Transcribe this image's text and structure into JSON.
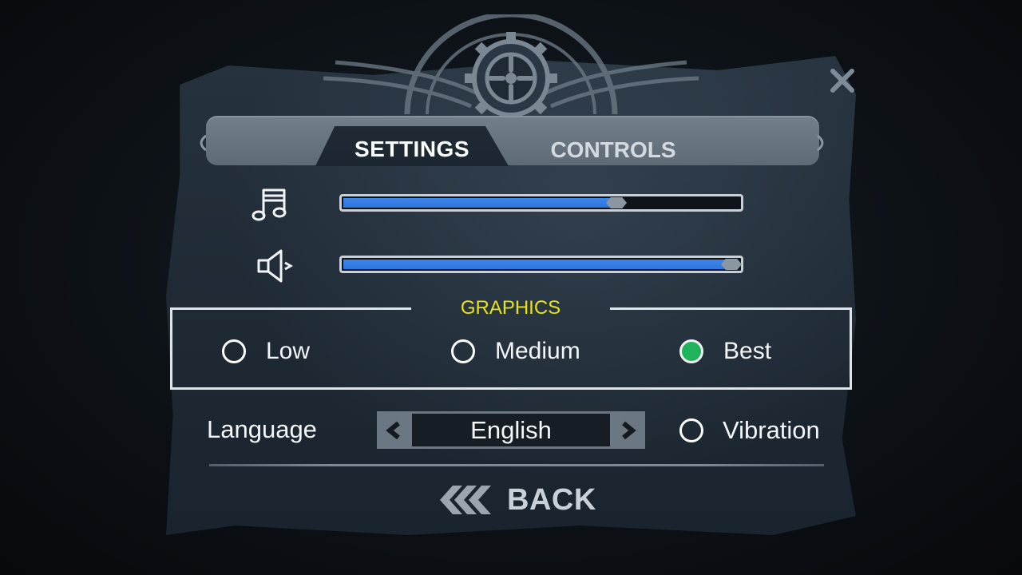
{
  "tabs": {
    "settings_label": "SETTINGS",
    "controls_label": "CONTROLS",
    "active": "settings"
  },
  "audio": {
    "music_icon": "music-note-icon",
    "music_level": 0.69,
    "sound_icon": "speaker-icon",
    "sound_level": 0.98,
    "fill_color": "#2f74dd"
  },
  "graphics": {
    "title": "GRAPHICS",
    "title_color": "#e8e21b",
    "options": [
      "Low",
      "Medium",
      "Best"
    ],
    "selected": "Best",
    "selected_color": "#1fb35b"
  },
  "language": {
    "label": "Language",
    "value": "English",
    "prev_icon": "chevron-left-icon",
    "next_icon": "chevron-right-icon"
  },
  "vibration": {
    "label": "Vibration",
    "enabled": false
  },
  "back": {
    "label": "BACK",
    "icon": "triple-chevron-left-icon"
  },
  "close_icon": "close-icon"
}
